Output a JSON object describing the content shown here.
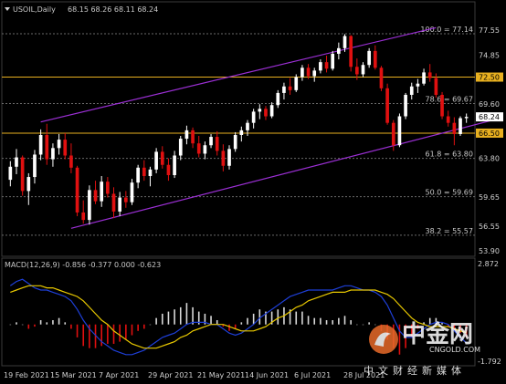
{
  "header": {
    "symbol": "USOIL,Daily",
    "ohlc": "68.15 68.26 68.11 68.24"
  },
  "colors": {
    "background": "#000000",
    "bull": "#ffffff",
    "bear": "#e01010",
    "channel": "#9b2fd4",
    "hline": "#e8b020",
    "fib_grid": "#6a6a6a",
    "macd_line": "#1e3fd8",
    "signal_line": "#e8c800",
    "hist_pos": "#d8d8d8",
    "hist_neg": "#e01010",
    "price_tag_bg": "#ffffff",
    "level_tag_bg": "#e8b020"
  },
  "chart_data": {
    "type": "candlestick",
    "price_axis": {
      "min": 53.5,
      "max": 79.0,
      "ticks": [
        "77.55",
        "74.85",
        "72.50",
        "69.60",
        "68.24",
        "66.50",
        "63.80",
        "59.65",
        "56.55",
        "53.90"
      ]
    },
    "fib_levels": [
      {
        "label": "100.0 = 77.14",
        "value": 77.14
      },
      {
        "label": "78.6 = 69.67",
        "value": 69.67
      },
      {
        "label": "61.8 = 63.80",
        "value": 63.8
      },
      {
        "label": "50.0 = 59.69",
        "value": 59.69
      },
      {
        "label": "38.2 = 55.57",
        "value": 55.57
      }
    ],
    "horizontal_lines": [
      {
        "label": "72.50",
        "value": 72.5
      },
      {
        "label": "66.50",
        "value": 66.5
      }
    ],
    "current_price": {
      "label": "68.24",
      "value": 68.24
    },
    "channel": {
      "upper": [
        [
          5,
          67.7
        ],
        [
          70,
          77.8
        ]
      ],
      "lower": [
        [
          10,
          56.3
        ],
        [
          80,
          68.0
        ]
      ]
    },
    "x_labels": [
      "19 Feb 2021",
      "15 Mar 2021",
      "7 Apr 2021",
      "29 Apr 2021",
      "21 May 2021",
      "14 Jun 2021",
      "6 Jul 2021",
      "28 Jul 2021"
    ],
    "candles": [
      [
        61.5,
        63.5,
        60.8,
        62.9
      ],
      [
        62.9,
        64.8,
        62.1,
        63.9
      ],
      [
        63.9,
        64.1,
        59.8,
        60.3
      ],
      [
        60.3,
        62.2,
        58.8,
        61.8
      ],
      [
        61.8,
        64.7,
        61.1,
        64.2
      ],
      [
        64.2,
        66.9,
        63.6,
        66.3
      ],
      [
        66.3,
        67.5,
        63.1,
        63.7
      ],
      [
        63.7,
        65.4,
        62.9,
        64.9
      ],
      [
        64.9,
        66.4,
        64.2,
        65.8
      ],
      [
        65.8,
        66.5,
        63.7,
        64.1
      ],
      [
        64.1,
        65.4,
        62.2,
        62.8
      ],
      [
        62.8,
        63.0,
        57.6,
        58.0
      ],
      [
        58.0,
        59.3,
        56.8,
        57.2
      ],
      [
        57.2,
        60.9,
        56.7,
        60.4
      ],
      [
        60.4,
        61.4,
        58.9,
        59.2
      ],
      [
        59.2,
        61.9,
        58.6,
        61.3
      ],
      [
        61.3,
        61.8,
        59.6,
        60.0
      ],
      [
        60.0,
        60.7,
        57.4,
        58.1
      ],
      [
        58.1,
        60.2,
        57.6,
        59.6
      ],
      [
        59.6,
        60.3,
        58.5,
        59.1
      ],
      [
        59.1,
        61.6,
        58.8,
        61.2
      ],
      [
        61.2,
        63.1,
        60.6,
        62.8
      ],
      [
        62.8,
        63.6,
        61.4,
        61.9
      ],
      [
        61.9,
        62.9,
        60.8,
        62.6
      ],
      [
        62.6,
        64.9,
        62.2,
        64.5
      ],
      [
        64.5,
        65.1,
        62.7,
        63.1
      ],
      [
        63.1,
        63.8,
        61.4,
        62.0
      ],
      [
        62.0,
        64.6,
        61.7,
        64.1
      ],
      [
        64.1,
        66.2,
        63.6,
        65.9
      ],
      [
        65.9,
        67.3,
        65.3,
        66.8
      ],
      [
        66.8,
        67.1,
        64.9,
        65.4
      ],
      [
        65.4,
        66.2,
        63.9,
        64.3
      ],
      [
        64.3,
        65.6,
        63.7,
        65.2
      ],
      [
        65.2,
        66.4,
        64.9,
        66.1
      ],
      [
        66.1,
        66.7,
        64.1,
        64.6
      ],
      [
        64.6,
        65.3,
        62.4,
        63.0
      ],
      [
        63.0,
        65.2,
        62.6,
        64.8
      ],
      [
        64.8,
        66.6,
        64.5,
        66.3
      ],
      [
        66.3,
        67.2,
        65.6,
        66.8
      ],
      [
        66.8,
        67.9,
        66.2,
        67.6
      ],
      [
        67.6,
        69.1,
        67.0,
        68.8
      ],
      [
        68.8,
        69.6,
        68.0,
        69.1
      ],
      [
        69.1,
        69.4,
        67.9,
        68.3
      ],
      [
        68.3,
        69.8,
        68.1,
        69.5
      ],
      [
        69.5,
        71.1,
        69.2,
        70.8
      ],
      [
        70.8,
        71.9,
        70.1,
        71.5
      ],
      [
        71.5,
        72.4,
        70.6,
        71.1
      ],
      [
        71.1,
        72.8,
        70.9,
        72.5
      ],
      [
        72.5,
        73.8,
        72.1,
        73.5
      ],
      [
        73.5,
        73.9,
        72.3,
        72.6
      ],
      [
        72.6,
        73.5,
        72.0,
        73.2
      ],
      [
        73.2,
        74.4,
        72.9,
        74.1
      ],
      [
        74.1,
        74.8,
        73.0,
        73.4
      ],
      [
        73.4,
        75.3,
        73.2,
        75.0
      ],
      [
        75.0,
        76.2,
        74.4,
        75.6
      ],
      [
        75.6,
        77.1,
        75.2,
        76.9
      ],
      [
        76.9,
        77.0,
        73.1,
        73.6
      ],
      [
        73.6,
        74.5,
        72.2,
        72.8
      ],
      [
        72.8,
        74.1,
        72.5,
        73.8
      ],
      [
        73.8,
        75.6,
        73.5,
        75.3
      ],
      [
        75.3,
        75.9,
        73.3,
        73.5
      ],
      [
        73.5,
        73.7,
        71.0,
        71.3
      ],
      [
        71.3,
        71.8,
        67.4,
        67.6
      ],
      [
        67.6,
        67.9,
        64.6,
        65.2
      ],
      [
        65.2,
        68.6,
        65.0,
        68.3
      ],
      [
        68.3,
        70.8,
        68.0,
        70.6
      ],
      [
        70.6,
        71.9,
        70.1,
        71.5
      ],
      [
        71.5,
        72.3,
        70.8,
        71.8
      ],
      [
        71.8,
        73.4,
        71.6,
        73.0
      ],
      [
        73.0,
        73.9,
        72.0,
        72.4
      ],
      [
        72.4,
        72.9,
        70.3,
        70.6
      ],
      [
        70.6,
        70.9,
        68.0,
        68.3
      ],
      [
        68.3,
        68.9,
        67.2,
        67.6
      ],
      [
        67.6,
        68.2,
        65.2,
        66.4
      ],
      [
        66.4,
        68.3,
        66.2,
        68.1
      ],
      [
        68.1,
        68.6,
        67.6,
        68.24
      ]
    ]
  },
  "macd": {
    "label": "MACD(12,26,9) -0.856 -0.377 0.000 -0.623",
    "axis_max": "2.872",
    "axis_min": "-1.792",
    "min": -1.792,
    "max": 2.872,
    "histogram": [
      0.0,
      0.1,
      0.0,
      -0.2,
      -0.1,
      0.2,
      0.1,
      0.2,
      0.3,
      0.1,
      -0.2,
      -0.6,
      -1.0,
      -1.1,
      -1.1,
      -1.0,
      -0.9,
      -0.9,
      -0.8,
      -0.7,
      -0.5,
      -0.3,
      -0.2,
      0.0,
      0.3,
      0.5,
      0.6,
      0.7,
      0.8,
      1.0,
      0.8,
      0.6,
      0.5,
      0.4,
      0.2,
      -0.1,
      -0.3,
      -0.2,
      0.1,
      0.3,
      0.5,
      0.7,
      0.6,
      0.6,
      0.7,
      0.8,
      0.7,
      0.6,
      0.6,
      0.4,
      0.3,
      0.3,
      0.2,
      0.2,
      0.3,
      0.4,
      0.2,
      0.0,
      0.0,
      0.1,
      0.0,
      -0.3,
      -0.7,
      -1.1,
      -1.4,
      -1.1,
      -0.6,
      -0.2,
      0.1,
      0.3,
      0.3,
      0.1,
      -0.1,
      -0.3,
      -0.4,
      -0.6
    ],
    "macd_line": [
      1.8,
      2.0,
      2.1,
      1.9,
      1.7,
      1.6,
      1.6,
      1.5,
      1.4,
      1.3,
      1.1,
      0.7,
      0.2,
      -0.2,
      -0.5,
      -0.8,
      -1.0,
      -1.2,
      -1.3,
      -1.4,
      -1.4,
      -1.3,
      -1.2,
      -1.0,
      -0.8,
      -0.6,
      -0.5,
      -0.4,
      -0.2,
      0.0,
      0.1,
      0.1,
      0.1,
      0.0,
      0.0,
      -0.2,
      -0.4,
      -0.5,
      -0.4,
      -0.2,
      0.0,
      0.3,
      0.5,
      0.7,
      0.9,
      1.1,
      1.3,
      1.4,
      1.5,
      1.6,
      1.6,
      1.6,
      1.6,
      1.6,
      1.7,
      1.8,
      1.8,
      1.7,
      1.6,
      1.6,
      1.5,
      1.3,
      0.9,
      0.3,
      -0.3,
      -0.6,
      -0.6,
      -0.4,
      -0.2,
      0.0,
      0.1,
      0.1,
      0.0,
      -0.3,
      -0.6,
      -0.86
    ],
    "signal_line": [
      1.5,
      1.6,
      1.7,
      1.8,
      1.8,
      1.8,
      1.7,
      1.7,
      1.6,
      1.5,
      1.4,
      1.3,
      1.1,
      0.8,
      0.5,
      0.2,
      0.0,
      -0.3,
      -0.5,
      -0.7,
      -0.9,
      -1.0,
      -1.1,
      -1.1,
      -1.1,
      -1.0,
      -0.9,
      -0.8,
      -0.6,
      -0.5,
      -0.3,
      -0.2,
      -0.1,
      0.0,
      0.0,
      0.0,
      -0.1,
      -0.2,
      -0.3,
      -0.3,
      -0.3,
      -0.2,
      -0.1,
      0.1,
      0.3,
      0.4,
      0.6,
      0.8,
      0.9,
      1.1,
      1.2,
      1.3,
      1.4,
      1.5,
      1.5,
      1.5,
      1.6,
      1.6,
      1.6,
      1.6,
      1.6,
      1.5,
      1.4,
      1.2,
      0.9,
      0.6,
      0.3,
      0.1,
      0.0,
      -0.1,
      -0.1,
      -0.1,
      -0.1,
      -0.2,
      -0.3,
      -0.38
    ]
  },
  "watermark": {
    "title": "中金网",
    "en": "CNGOLD.COM",
    "sub": "中文财经新媒体"
  }
}
